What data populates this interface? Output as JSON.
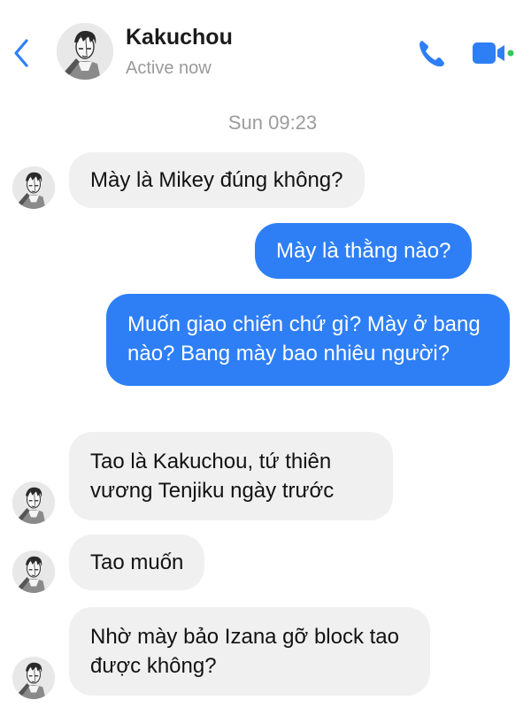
{
  "header": {
    "name": "Kakuchou",
    "status": "Active now",
    "back_icon": "chevron-left-icon",
    "call_icon": "phone-icon",
    "video_icon": "video-camera-icon",
    "accent_color": "#2e7ff6",
    "online_color": "#34c759"
  },
  "timestamp": "Sun 09:23",
  "messages": [
    {
      "sender": "Kakuchou",
      "direction": "incoming",
      "text": "Mày là Mikey đúng không?"
    },
    {
      "sender": "me",
      "direction": "outgoing",
      "text": "Mày là thằng nào?"
    },
    {
      "sender": "me",
      "direction": "outgoing",
      "text": "Muốn giao chiến chứ gì? Mày ở bang nào? Bang mày bao nhiêu người?"
    },
    {
      "sender": "Kakuchou",
      "direction": "incoming",
      "text": "Tao là Kakuchou, tứ thiên vương Tenjiku ngày trước"
    },
    {
      "sender": "Kakuchou",
      "direction": "incoming",
      "text": "Tao muốn"
    },
    {
      "sender": "Kakuchou",
      "direction": "incoming",
      "text": "Nhờ mày bảo Izana gỡ block tao được không?"
    }
  ]
}
